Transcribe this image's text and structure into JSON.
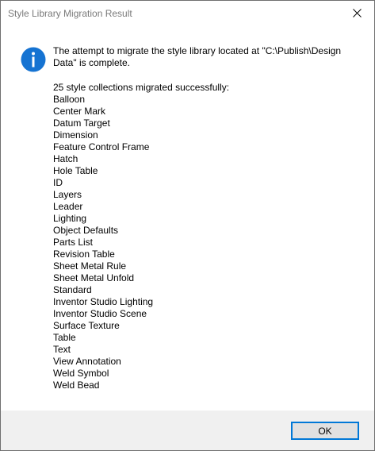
{
  "window": {
    "title": "Style Library Migration Result"
  },
  "icons": {
    "close": "close-icon",
    "info": "info-icon"
  },
  "colors": {
    "info_icon": "#1573d2",
    "ok_border": "#0078d7",
    "footer_bg": "#f0f0f0",
    "title_text": "#7a7a7a"
  },
  "message": {
    "line1": "The attempt to migrate the style library located at \"C:\\Publish\\Design",
    "line2": "Data\" is complete."
  },
  "summary": "25 style collections migrated successfully:",
  "collections": [
    "Balloon",
    "Center Mark",
    "Datum Target",
    "Dimension",
    "Feature Control Frame",
    "Hatch",
    "Hole Table",
    "ID",
    "Layers",
    "Leader",
    "Lighting",
    "Object Defaults",
    "Parts List",
    "Revision Table",
    "Sheet Metal Rule",
    "Sheet Metal Unfold",
    "Standard",
    "Inventor Studio Lighting",
    "Inventor Studio Scene",
    "Surface Texture",
    "Table",
    "Text",
    "View Annotation",
    "Weld Symbol",
    "Weld Bead"
  ],
  "buttons": {
    "ok_label": "OK"
  }
}
